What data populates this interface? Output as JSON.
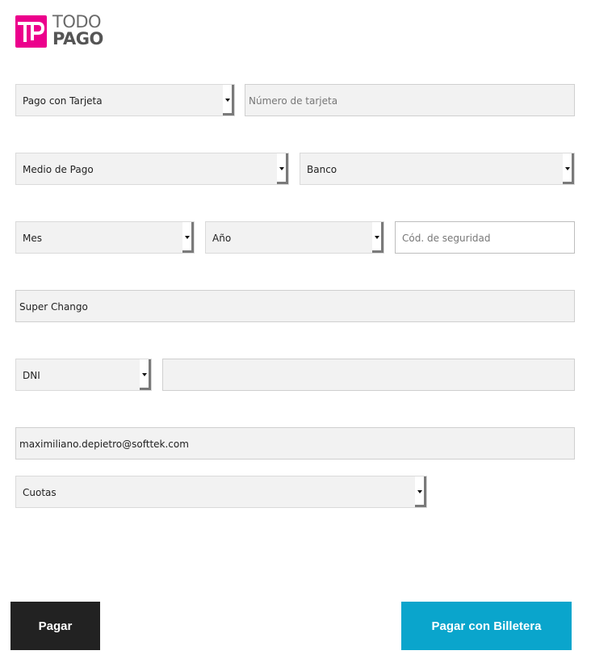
{
  "brand": {
    "logo_mark": "TP",
    "line1": "TODO",
    "line2": "PAGO",
    "color": "#ec008c"
  },
  "form": {
    "payment_type": "Pago con Tarjeta",
    "card_number_placeholder": "Número de tarjeta",
    "payment_method": "Medio de Pago",
    "bank": "Banco",
    "month": "Mes",
    "year": "Año",
    "security_code_placeholder": "Cód. de seguridad",
    "cardholder_name": "Super Chango",
    "document_type": "DNI",
    "document_number": "",
    "email": "maximiliano.depietro@softtek.com",
    "installments": "Cuotas"
  },
  "buttons": {
    "pay": "Pagar",
    "pay_wallet": "Pagar con Billetera"
  },
  "colors": {
    "pay_button": "#222222",
    "wallet_button": "#0aa5cc"
  }
}
